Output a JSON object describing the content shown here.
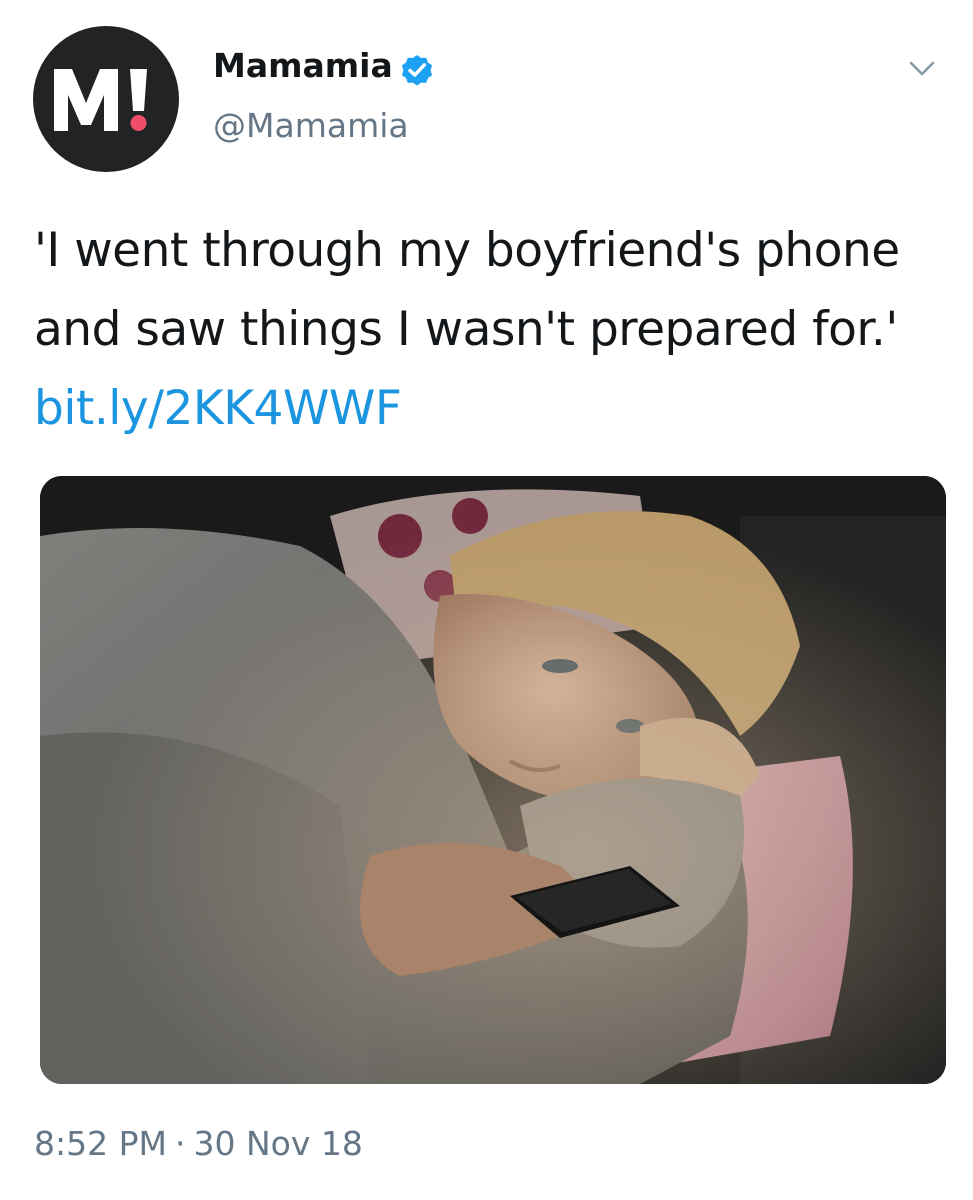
{
  "account": {
    "display_name": "Mamamia",
    "handle": "@Mamamia",
    "verified": true,
    "avatar_logo": "M!",
    "avatar_icon": "mamamia-logo-icon",
    "colors": {
      "avatar_bg": "#222324",
      "logo_text": "#ffffff",
      "logo_dot": "#ef4e6b",
      "verified": "#1da1f2"
    }
  },
  "tweet": {
    "text": "'I went through my boyfriend's phone and saw things I wasn't prepared for.'",
    "link": "bit.ly/2KK4WWF",
    "link_color": "#1b95e0"
  },
  "media": {
    "type": "photo"
  },
  "meta": {
    "time": "8:52 PM",
    "separator": "·",
    "date": "30 Nov 18"
  },
  "icons": {
    "verified": "verified-badge-icon",
    "menu": "chevron-down-icon"
  }
}
